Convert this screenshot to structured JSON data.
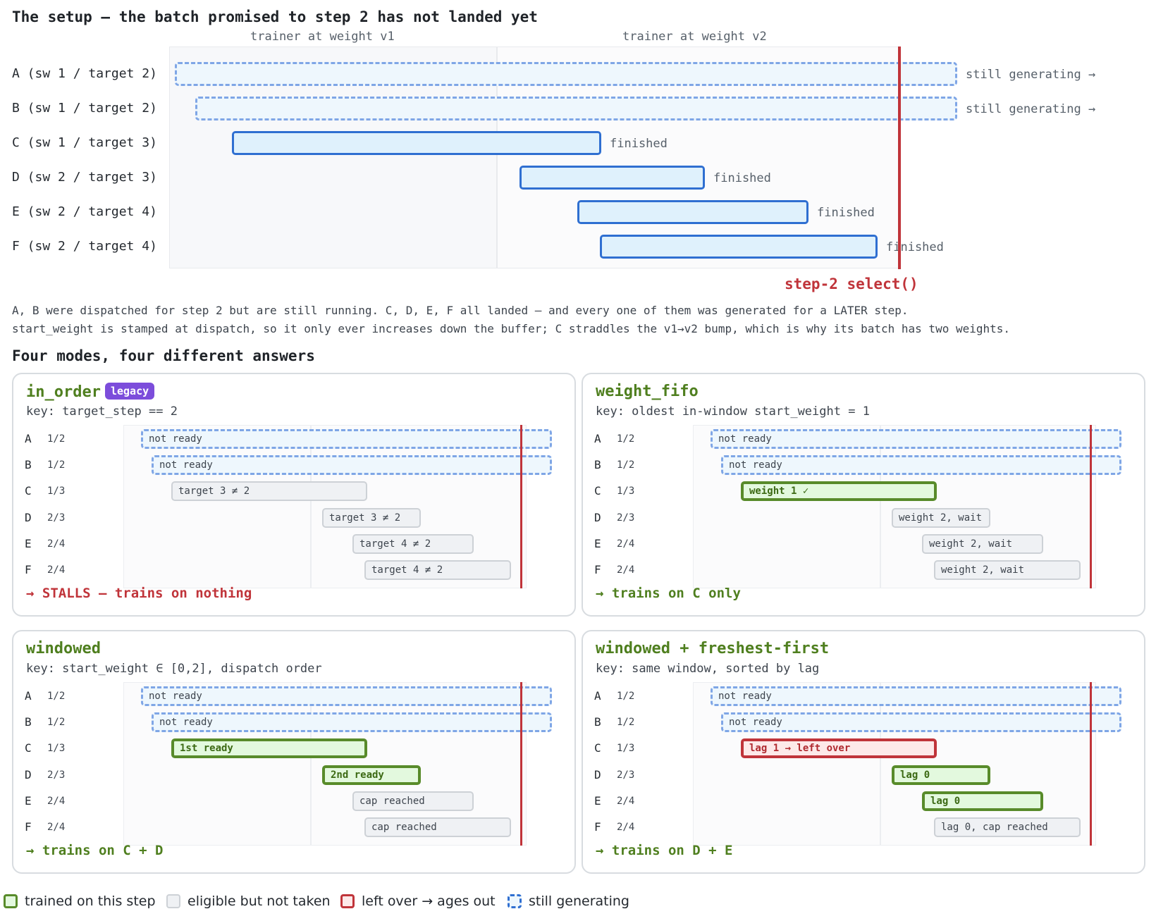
{
  "setup": {
    "title": "The setup — the batch promised to step 2 has not landed yet",
    "col_v1": "trainer at weight v1",
    "col_v2": "trainer at weight v2",
    "rows": [
      {
        "label": "A (sw 1 / target 2)",
        "note": "still generating →",
        "status": "generating"
      },
      {
        "label": "B (sw 1 / target 2)",
        "note": "still generating →",
        "status": "generating"
      },
      {
        "label": "C (sw 1 / target 3)",
        "note": "finished",
        "status": "finished"
      },
      {
        "label": "D (sw 2 / target 3)",
        "note": "finished",
        "status": "finished"
      },
      {
        "label": "E (sw 2 / target 4)",
        "note": "finished",
        "status": "finished"
      },
      {
        "label": "F (sw 2 / target 4)",
        "note": "finished",
        "status": "finished"
      }
    ],
    "select_label": "step-2 select()",
    "para1": "A, B were dispatched for step 2 but are still running. C, D, E, F all landed — and every one of them was generated for a LATER step.",
    "para2": "start_weight is stamped at dispatch, so it only ever increases down the buffer; C straddles the v1→v2 bump, which is why its batch has two weights."
  },
  "modes": {
    "title": "Four modes, four different answers",
    "cards": [
      {
        "title": "in_order",
        "badge": "legacy",
        "key": "key: target_step == 2",
        "verdict": "→ STALLS — trains on nothing",
        "verdict_kind": "bad",
        "rows": [
          {
            "letter": "A",
            "frac": "1/2",
            "text": "not ready",
            "state": "gen"
          },
          {
            "letter": "B",
            "frac": "1/2",
            "text": "not ready",
            "state": "gen"
          },
          {
            "letter": "C",
            "frac": "1/3",
            "text": "target 3 ≠ 2",
            "state": "elig"
          },
          {
            "letter": "D",
            "frac": "2/3",
            "text": "target 3 ≠ 2",
            "state": "elig"
          },
          {
            "letter": "E",
            "frac": "2/4",
            "text": "target 4 ≠ 2",
            "state": "elig"
          },
          {
            "letter": "F",
            "frac": "2/4",
            "text": "target 4 ≠ 2",
            "state": "elig"
          }
        ]
      },
      {
        "title": "weight_fifo",
        "badge": "",
        "key": "key: oldest in-window start_weight = 1",
        "verdict": "→ trains on C only",
        "verdict_kind": "good",
        "rows": [
          {
            "letter": "A",
            "frac": "1/2",
            "text": "not ready",
            "state": "gen"
          },
          {
            "letter": "B",
            "frac": "1/2",
            "text": "not ready",
            "state": "gen"
          },
          {
            "letter": "C",
            "frac": "1/3",
            "text": "weight 1 ✓",
            "state": "train"
          },
          {
            "letter": "D",
            "frac": "2/3",
            "text": "weight 2, wait",
            "state": "elig"
          },
          {
            "letter": "E",
            "frac": "2/4",
            "text": "weight 2, wait",
            "state": "elig"
          },
          {
            "letter": "F",
            "frac": "2/4",
            "text": "weight 2, wait",
            "state": "elig"
          }
        ]
      },
      {
        "title": "windowed",
        "badge": "",
        "key": "key: start_weight ∈ [0,2], dispatch order",
        "verdict": "→ trains on C + D",
        "verdict_kind": "good",
        "rows": [
          {
            "letter": "A",
            "frac": "1/2",
            "text": "not ready",
            "state": "gen"
          },
          {
            "letter": "B",
            "frac": "1/2",
            "text": "not ready",
            "state": "gen"
          },
          {
            "letter": "C",
            "frac": "1/3",
            "text": "1st ready",
            "state": "train"
          },
          {
            "letter": "D",
            "frac": "2/3",
            "text": "2nd ready",
            "state": "train"
          },
          {
            "letter": "E",
            "frac": "2/4",
            "text": "cap reached",
            "state": "elig"
          },
          {
            "letter": "F",
            "frac": "2/4",
            "text": "cap reached",
            "state": "elig"
          }
        ]
      },
      {
        "title": "windowed + freshest-first",
        "badge": "",
        "key": "key: same window, sorted by lag",
        "verdict": "→ trains on D + E",
        "verdict_kind": "good",
        "rows": [
          {
            "letter": "A",
            "frac": "1/2",
            "text": "not ready",
            "state": "gen"
          },
          {
            "letter": "B",
            "frac": "1/2",
            "text": "not ready",
            "state": "gen"
          },
          {
            "letter": "C",
            "frac": "1/3",
            "text": "lag 1 → left over",
            "state": "left"
          },
          {
            "letter": "D",
            "frac": "2/3",
            "text": "lag 0",
            "state": "train"
          },
          {
            "letter": "E",
            "frac": "2/4",
            "text": "lag 0",
            "state": "train"
          },
          {
            "letter": "F",
            "frac": "2/4",
            "text": "lag 0, cap reached",
            "state": "elig"
          }
        ]
      }
    ]
  },
  "legend": {
    "trained": "trained on this step",
    "eligible": "eligible but not taken",
    "left_over": "left over → ages out",
    "generating": "still generating"
  },
  "colors": {
    "select_line": "#c0343a",
    "trained": "#588b2a",
    "generating": "#7fa6e6",
    "finished": "#2f6fd1",
    "badge": "#7c4ddb"
  }
}
